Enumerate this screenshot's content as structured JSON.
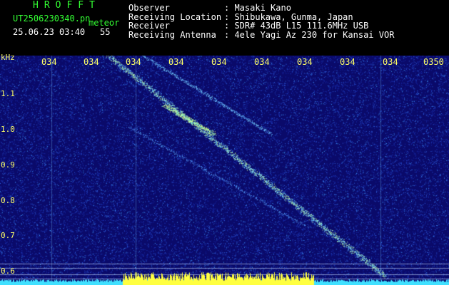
{
  "header": {
    "app_title": "HROFFT",
    "filename": "UT2506230340.pn",
    "tag": "meteor",
    "datetime": "25.06.23 03:40",
    "count": "55",
    "fields": [
      {
        "label": "Observer",
        "value": ": Masaki Kano"
      },
      {
        "label": "Receiving Location",
        "value": ": Shibukawa, Gunma, Japan"
      },
      {
        "label": "Receiver",
        "value": ": SDR# 43dB L15 111.6MHz USB"
      },
      {
        "label": "Receiving Antenna",
        "value": ": 4ele Yagi Az 230 for Kansai VOR"
      }
    ]
  },
  "axes": {
    "y_unit": "kHz",
    "x_ticks": [
      "034",
      "034",
      "034",
      "034",
      "034",
      "034",
      "034",
      "034",
      "034",
      "0350"
    ],
    "y_ticks": [
      "1.1",
      "1.0",
      "0.9",
      "0.8",
      "0.7",
      "0.6"
    ]
  },
  "colors": {
    "background": "#000000",
    "plot_bg": "#0a0a6a",
    "signal": "#7fd8ff",
    "tick": "#ffff66",
    "header_green": "#33ff33",
    "header_white": "#ffffff"
  }
}
